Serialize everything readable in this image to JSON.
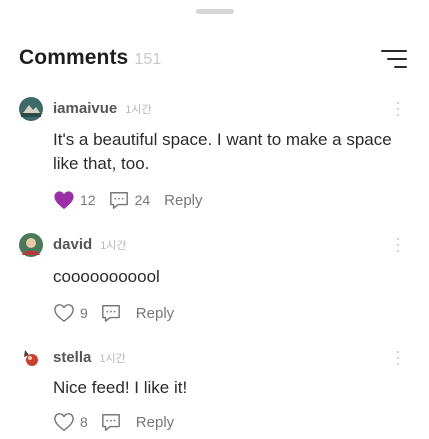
{
  "header": {
    "title": "Comments",
    "count": "151"
  },
  "colors": {
    "liked_heart": "#9b2fa5",
    "avatar_1": "#3d6a68",
    "avatar_2": "#4a7a5a",
    "avatar_3": "#5b3b2e"
  },
  "comments": [
    {
      "user": "iamaivue",
      "time": "1시간",
      "text": "It's a beautiful space. I want to make a space like that, too.",
      "likes": "12",
      "replies": "24",
      "reply_label": "Reply",
      "liked": true
    },
    {
      "user": "david",
      "time": "1시간",
      "text": "cooooooooool",
      "likes": "9",
      "replies": "",
      "reply_label": "Reply",
      "liked": false
    },
    {
      "user": "stella",
      "time": "1시간",
      "text": "Nice feed! I like it!",
      "likes": "8",
      "replies": "",
      "reply_label": "Reply",
      "liked": false
    }
  ]
}
